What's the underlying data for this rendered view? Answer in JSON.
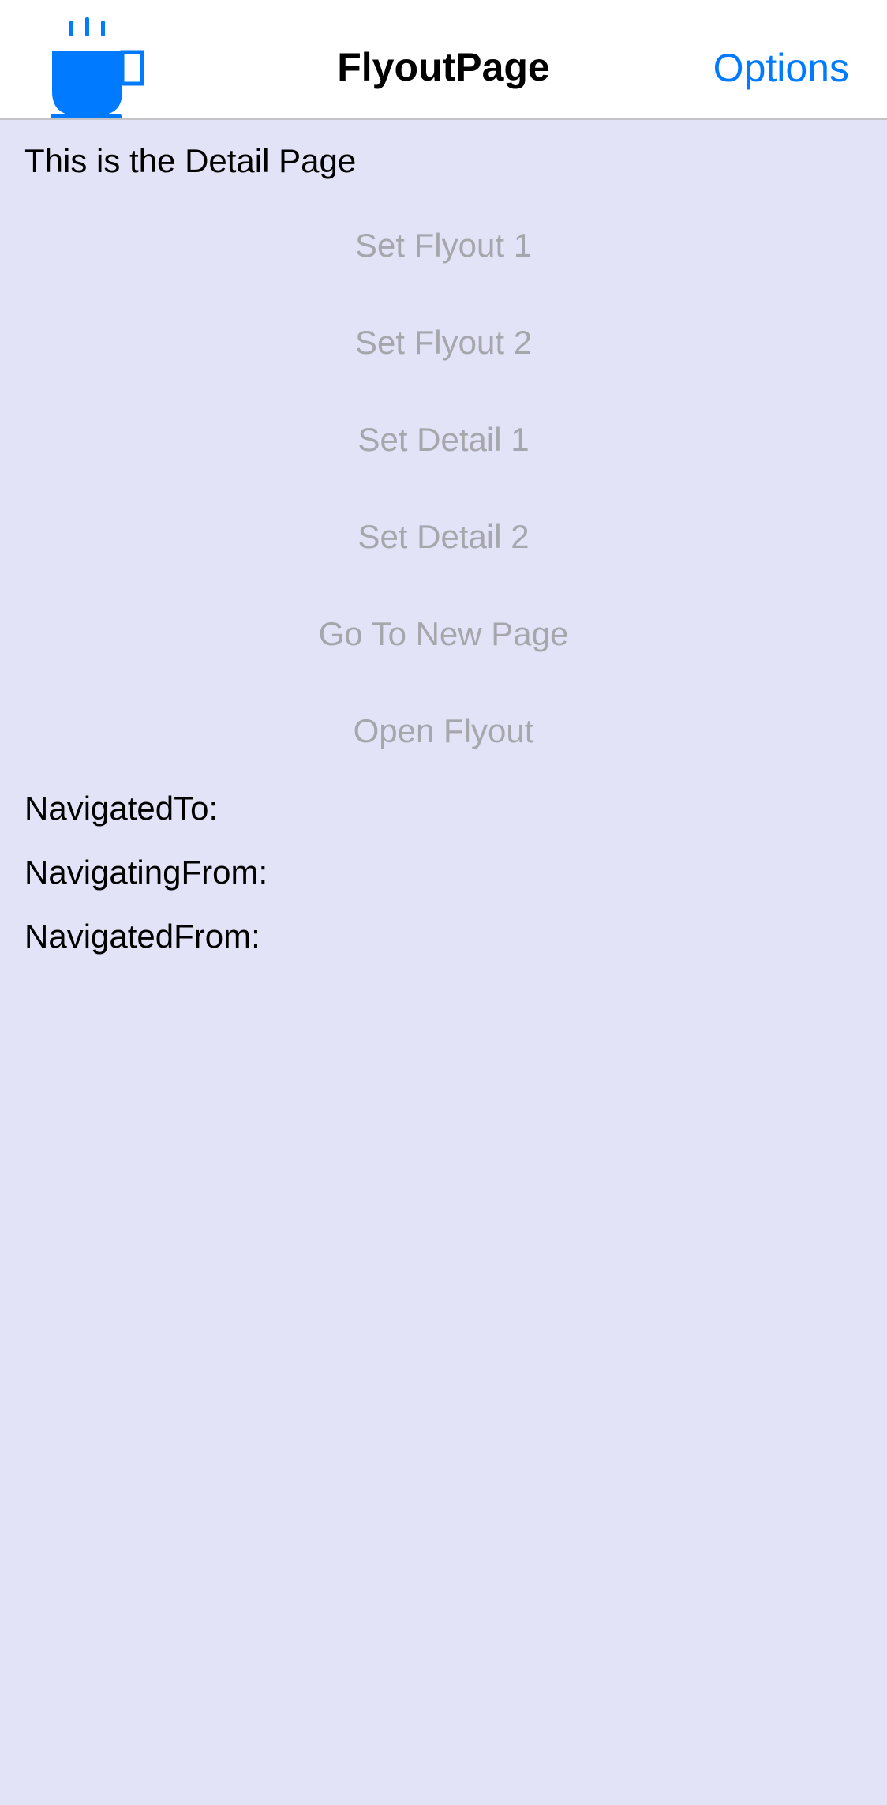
{
  "navbar": {
    "icon": "coffee-cup-icon",
    "title": "FlyoutPage",
    "options_label": "Options"
  },
  "detail": {
    "heading": "This is the Detail Page",
    "buttons": [
      {
        "label": "Set Flyout 1"
      },
      {
        "label": "Set Flyout 2"
      },
      {
        "label": "Set Detail 1"
      },
      {
        "label": "Set Detail 2"
      },
      {
        "label": "Go To New Page"
      },
      {
        "label": "Open Flyout"
      }
    ],
    "navigated_to_label": "NavigatedTo:",
    "navigating_from_label": "NavigatingFrom:",
    "navigated_from_label": "NavigatedFrom:"
  },
  "colors": {
    "accent": "#007AFF",
    "background": "#E3E3F7",
    "disabled_text": "#A6A6AD",
    "navbar_background": "#FFFFFF"
  }
}
